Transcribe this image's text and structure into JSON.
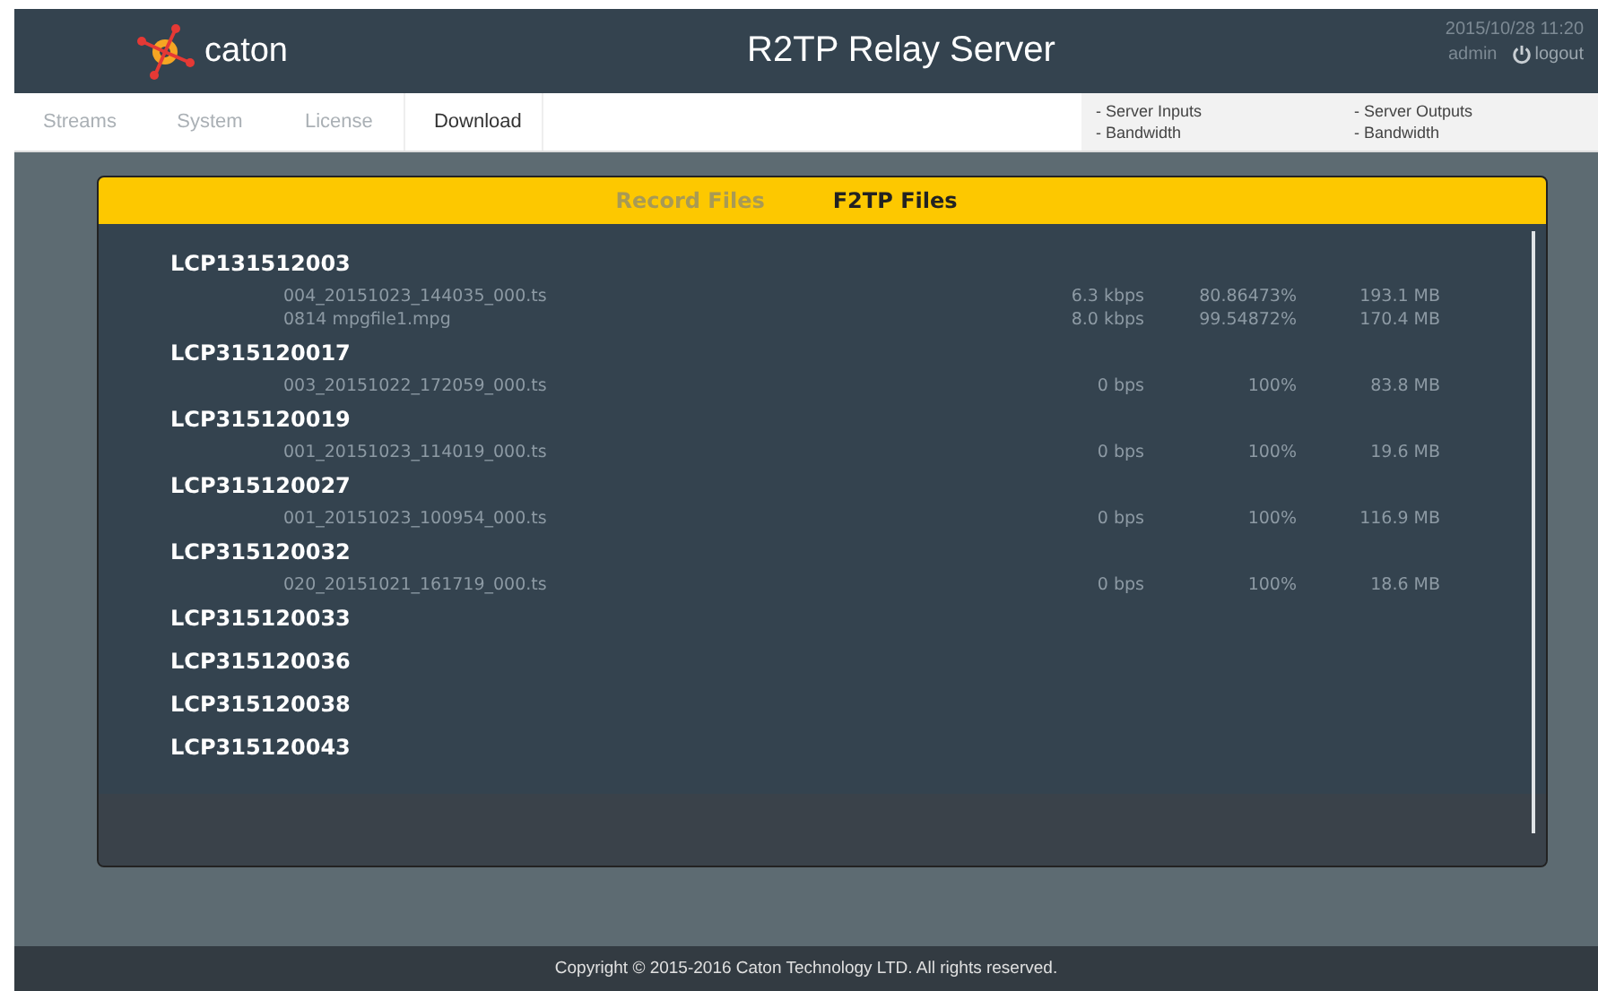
{
  "header": {
    "logo_text": "caton",
    "title": "R2TP Relay Server",
    "datetime": "2015/10/28 11:20",
    "user": "admin",
    "logout": "logout"
  },
  "tabs": [
    {
      "label": "Streams",
      "selected": false
    },
    {
      "label": "System",
      "selected": false
    },
    {
      "label": "License",
      "selected": false
    },
    {
      "label": "Download",
      "selected": true
    }
  ],
  "stat_links": [
    [
      "- Server Inputs",
      "- Bandwidth"
    ],
    [
      "- Server Outputs",
      "- Bandwidth"
    ]
  ],
  "panel_tabs": [
    {
      "label": "Record Files",
      "selected": false
    },
    {
      "label": "F2TP Files",
      "selected": true
    }
  ],
  "groups": [
    {
      "name": "LCP131512003",
      "files": [
        {
          "name": "004_20151023_144035_000.ts",
          "rate": "6.3 kbps",
          "percent": "80.86473%",
          "size": "193.1 MB"
        },
        {
          "name": "0814 mpgfile1.mpg",
          "rate": "8.0 kbps",
          "percent": "99.54872%",
          "size": "170.4 MB"
        }
      ]
    },
    {
      "name": "LCP315120017",
      "files": [
        {
          "name": "003_20151022_172059_000.ts",
          "rate": "0 bps",
          "percent": "100%",
          "size": "83.8 MB"
        }
      ]
    },
    {
      "name": "LCP315120019",
      "files": [
        {
          "name": "001_20151023_114019_000.ts",
          "rate": "0 bps",
          "percent": "100%",
          "size": "19.6 MB"
        }
      ]
    },
    {
      "name": "LCP315120027",
      "files": [
        {
          "name": "001_20151023_100954_000.ts",
          "rate": "0 bps",
          "percent": "100%",
          "size": "116.9 MB"
        }
      ]
    },
    {
      "name": "LCP315120032",
      "files": [
        {
          "name": "020_20151021_161719_000.ts",
          "rate": "0 bps",
          "percent": "100%",
          "size": "18.6 MB"
        }
      ]
    },
    {
      "name": "LCP315120033"
    },
    {
      "name": "LCP315120036"
    },
    {
      "name": "LCP315120038"
    },
    {
      "name": "LCP315120043"
    }
  ],
  "footer": "Copyright © 2015-2016 Caton Technology LTD. All rights reserved."
}
